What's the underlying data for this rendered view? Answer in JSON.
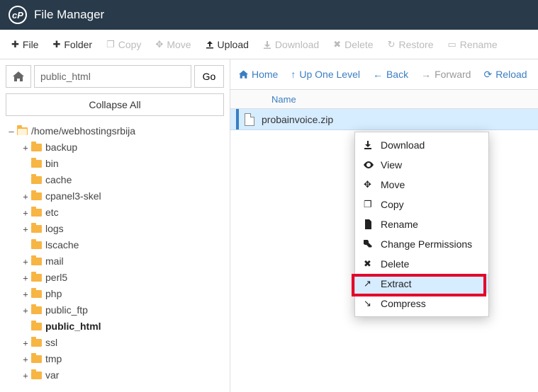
{
  "header": {
    "title": "File Manager"
  },
  "toolbar": [
    {
      "label": "File",
      "disabled": false
    },
    {
      "label": "Folder",
      "disabled": false
    },
    {
      "label": "Copy",
      "disabled": true
    },
    {
      "label": "Move",
      "disabled": true
    },
    {
      "label": "Upload",
      "disabled": false
    },
    {
      "label": "Download",
      "disabled": true
    },
    {
      "label": "Delete",
      "disabled": true
    },
    {
      "label": "Restore",
      "disabled": true
    },
    {
      "label": "Rename",
      "disabled": true
    }
  ],
  "path": {
    "value": "public_html",
    "go": "Go"
  },
  "collapse_label": "Collapse All",
  "tree": {
    "root": {
      "label": "/home/webhostingsrbija"
    },
    "children": [
      {
        "label": "backup",
        "expandable": true
      },
      {
        "label": "bin",
        "expandable": false
      },
      {
        "label": "cache",
        "expandable": false
      },
      {
        "label": "cpanel3-skel",
        "expandable": true
      },
      {
        "label": "etc",
        "expandable": true
      },
      {
        "label": "logs",
        "expandable": true
      },
      {
        "label": "lscache",
        "expandable": false
      },
      {
        "label": "mail",
        "expandable": true
      },
      {
        "label": "perl5",
        "expandable": true
      },
      {
        "label": "php",
        "expandable": true
      },
      {
        "label": "public_ftp",
        "expandable": true
      },
      {
        "label": "public_html",
        "expandable": false,
        "active": true
      },
      {
        "label": "ssl",
        "expandable": true
      },
      {
        "label": "tmp",
        "expandable": true
      },
      {
        "label": "var",
        "expandable": true
      }
    ]
  },
  "navbar": [
    {
      "label": "Home",
      "disabled": false
    },
    {
      "label": "Up One Level",
      "disabled": false
    },
    {
      "label": "Back",
      "disabled": false
    },
    {
      "label": "Forward",
      "disabled": true
    },
    {
      "label": "Reload",
      "disabled": false
    }
  ],
  "column_name": "Name",
  "file": {
    "name": "probainvoice.zip"
  },
  "context_menu": [
    {
      "label": "Download"
    },
    {
      "label": "View"
    },
    {
      "label": "Move"
    },
    {
      "label": "Copy"
    },
    {
      "label": "Rename"
    },
    {
      "label": "Change Permissions"
    },
    {
      "label": "Delete"
    },
    {
      "label": "Extract",
      "hovered": true
    },
    {
      "label": "Compress"
    }
  ]
}
